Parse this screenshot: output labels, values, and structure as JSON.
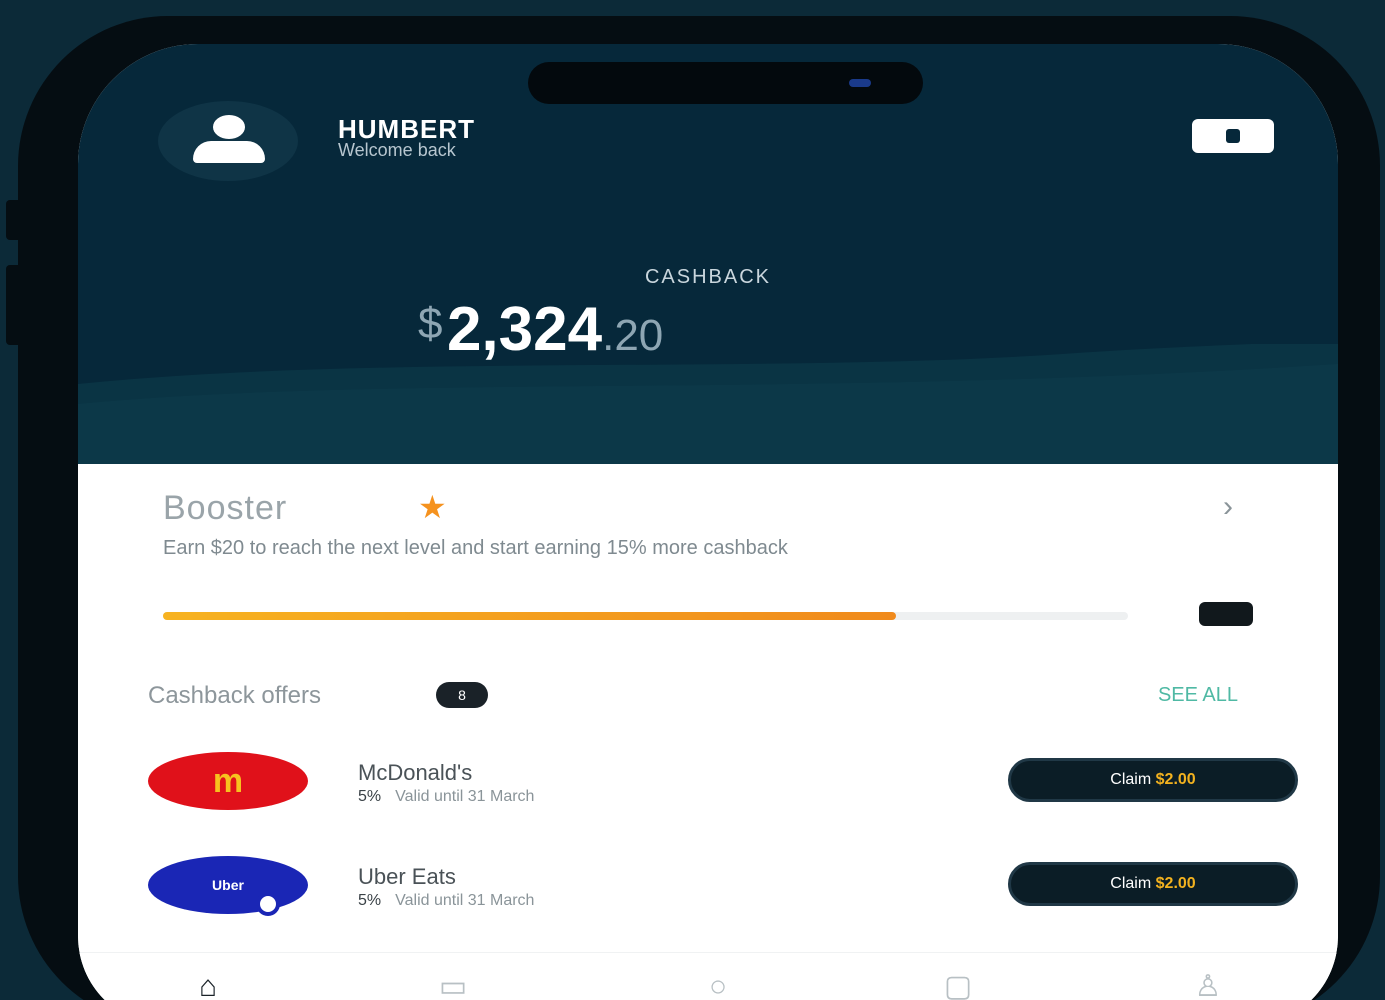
{
  "header": {
    "user_name": "HUMBERT",
    "user_sub": "Welcome back",
    "balance_label": "CASHBACK",
    "balance_currency": "$",
    "balance_whole": "2,324",
    "balance_decimal": ".20"
  },
  "booster": {
    "title": "Booster",
    "description": "Earn $20 to reach the next level and start earning 15% more cashback",
    "progress_fraction": 0.76
  },
  "cashback_offers": {
    "label": "Cashback offers",
    "count": "8",
    "see_all": "SEE ALL",
    "items": [
      {
        "name": "McDonald's",
        "pct": "5%",
        "status": "Valid until 31 March",
        "claim_label": "Claim",
        "claim_amount": "$2.00",
        "logo_text": "m"
      },
      {
        "name": "Uber Eats",
        "pct": "5%",
        "status": "Valid until 31 March",
        "claim_label": "Claim",
        "claim_amount": "$2.00",
        "logo_text": "Uber"
      }
    ]
  },
  "tabs": [
    "home-icon",
    "cards-icon",
    "search-icon",
    "wallet-icon",
    "profile-icon"
  ],
  "colors": {
    "header_bg": "#06283a",
    "accent_orange": "#f5921e",
    "claim_amount": "#f3b21f",
    "see_all": "#4fb9a4"
  }
}
